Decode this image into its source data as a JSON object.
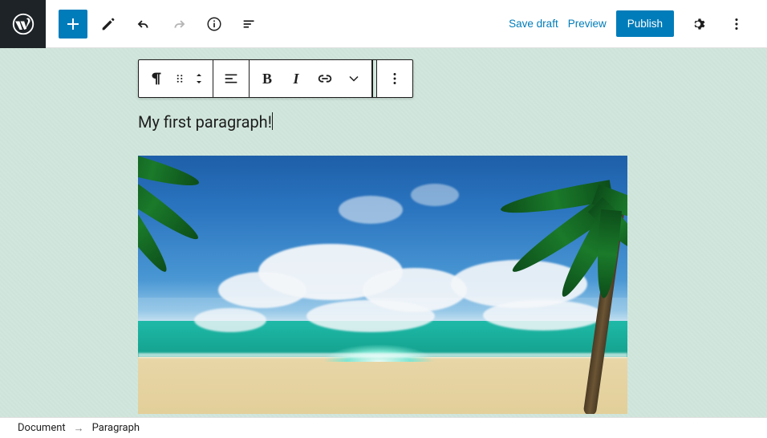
{
  "header": {
    "save_draft": "Save draft",
    "preview": "Preview",
    "publish": "Publish"
  },
  "block_toolbar": {
    "bold_glyph": "B",
    "italic_glyph": "I"
  },
  "editor": {
    "paragraph_text": "My first paragraph!"
  },
  "breadcrumb": {
    "root": "Document",
    "separator": "→",
    "current": "Paragraph"
  },
  "icons": {
    "wordpress": "wordpress-logo",
    "add": "plus-icon",
    "tools": "pencil-icon",
    "undo": "undo-icon",
    "redo": "redo-icon",
    "info": "info-icon",
    "outline": "list-view-icon",
    "settings": "gear-icon",
    "more": "more-vertical-icon",
    "block_type": "paragraph-icon",
    "drag": "drag-handle-icon",
    "move": "move-updown-icon",
    "align": "align-left-icon",
    "link": "link-icon",
    "chevron": "chevron-down-icon",
    "block_more": "more-vertical-icon"
  },
  "colors": {
    "accent": "#007cba",
    "canvas_bg": "#d1e7dd",
    "text": "#1e1e1e"
  }
}
